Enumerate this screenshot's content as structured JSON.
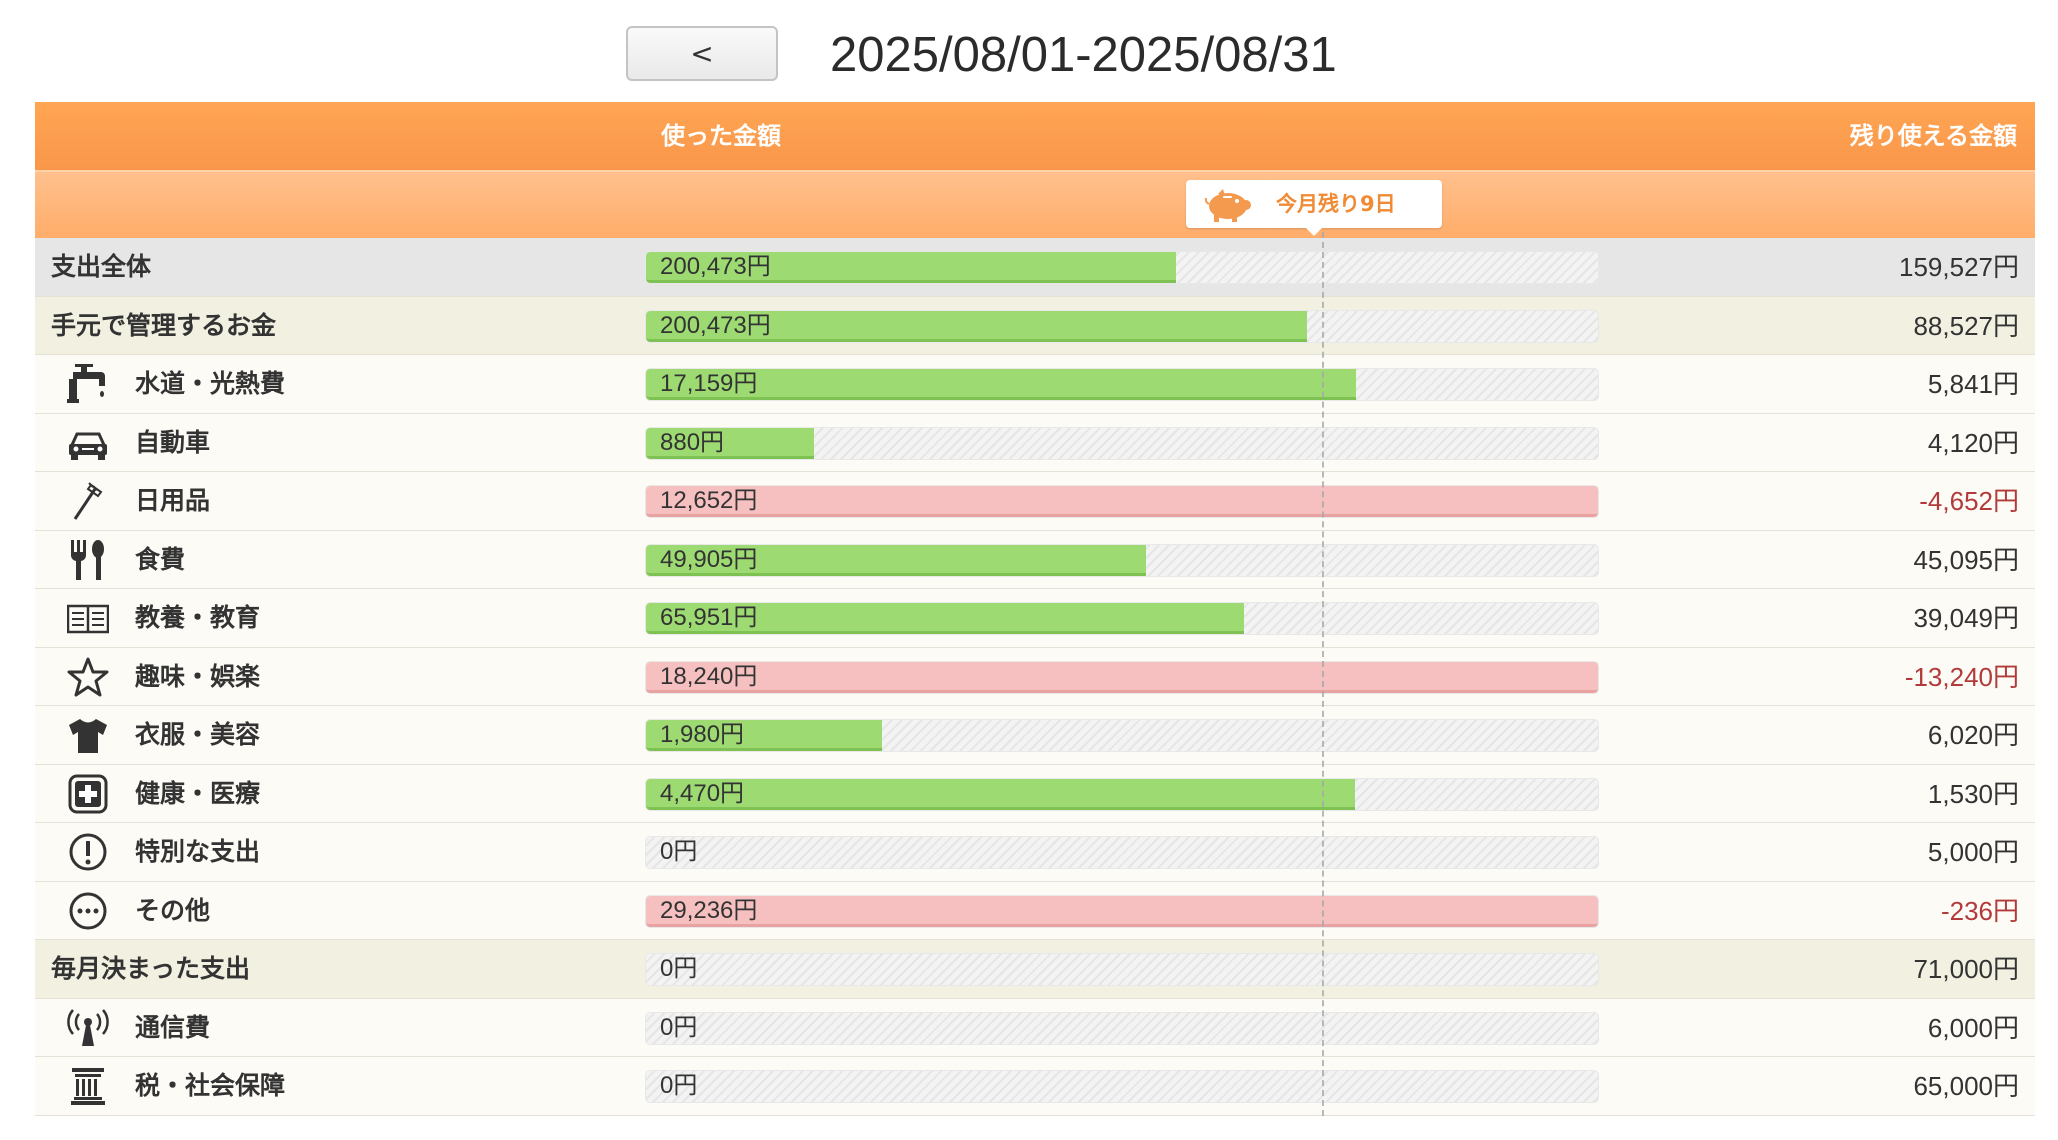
{
  "nav": {
    "back_label": "<"
  },
  "period": "2025/08/01-2025/08/31",
  "header": {
    "used_label": "使った金額",
    "remaining_label": "残り使える金額"
  },
  "badge": {
    "text": "今月残り9日"
  },
  "colors": {
    "header": "#f9964a",
    "bar_ok": "#9dda72",
    "bar_over": "#f6c0c0",
    "negative": "#b23a3a"
  },
  "rows": [
    {
      "kind": "total",
      "label": "支出全体",
      "icon": "",
      "used": "200,473円",
      "remaining": "159,527円",
      "fill_pct": 55.7,
      "over": false
    },
    {
      "kind": "group",
      "label": "手元で管理するお金",
      "icon": "",
      "used": "200,473円",
      "remaining": "88,527円",
      "fill_pct": 69.4,
      "over": false
    },
    {
      "kind": "item",
      "label": "水道・光熱費",
      "icon": "faucet-icon",
      "used": "17,159円",
      "remaining": "5,841円",
      "fill_pct": 74.6,
      "over": false
    },
    {
      "kind": "item",
      "label": "自動車",
      "icon": "car-icon",
      "used": "880円",
      "remaining": "4,120円",
      "fill_pct": 17.6,
      "over": false
    },
    {
      "kind": "item",
      "label": "日用品",
      "icon": "toothbrush-icon",
      "used": "12,652円",
      "remaining": "-4,652円",
      "fill_pct": 100,
      "over": true
    },
    {
      "kind": "item",
      "label": "食費",
      "icon": "utensils-icon",
      "used": "49,905円",
      "remaining": "45,095円",
      "fill_pct": 52.5,
      "over": false
    },
    {
      "kind": "item",
      "label": "教養・教育",
      "icon": "book-icon",
      "used": "65,951円",
      "remaining": "39,049円",
      "fill_pct": 62.8,
      "over": false
    },
    {
      "kind": "item",
      "label": "趣味・娯楽",
      "icon": "star-icon",
      "used": "18,240円",
      "remaining": "-13,240円",
      "fill_pct": 100,
      "over": true
    },
    {
      "kind": "item",
      "label": "衣服・美容",
      "icon": "shirt-icon",
      "used": "1,980円",
      "remaining": "6,020円",
      "fill_pct": 24.8,
      "over": false
    },
    {
      "kind": "item",
      "label": "健康・医療",
      "icon": "medical-cross-icon",
      "used": "4,470円",
      "remaining": "1,530円",
      "fill_pct": 74.5,
      "over": false
    },
    {
      "kind": "item",
      "label": "特別な支出",
      "icon": "exclamation-icon",
      "used": "0円",
      "remaining": "5,000円",
      "fill_pct": 0,
      "over": false
    },
    {
      "kind": "item",
      "label": "その他",
      "icon": "ellipsis-icon",
      "used": "29,236円",
      "remaining": "-236円",
      "fill_pct": 100,
      "over": true
    },
    {
      "kind": "group",
      "label": "毎月決まった支出",
      "icon": "",
      "used": "0円",
      "remaining": "71,000円",
      "fill_pct": 0,
      "over": false
    },
    {
      "kind": "item",
      "label": "通信費",
      "icon": "antenna-icon",
      "used": "0円",
      "remaining": "6,000円",
      "fill_pct": 0,
      "over": false
    },
    {
      "kind": "item",
      "label": "税・社会保障",
      "icon": "building-icon",
      "used": "0円",
      "remaining": "65,000円",
      "fill_pct": 0,
      "over": false
    }
  ]
}
